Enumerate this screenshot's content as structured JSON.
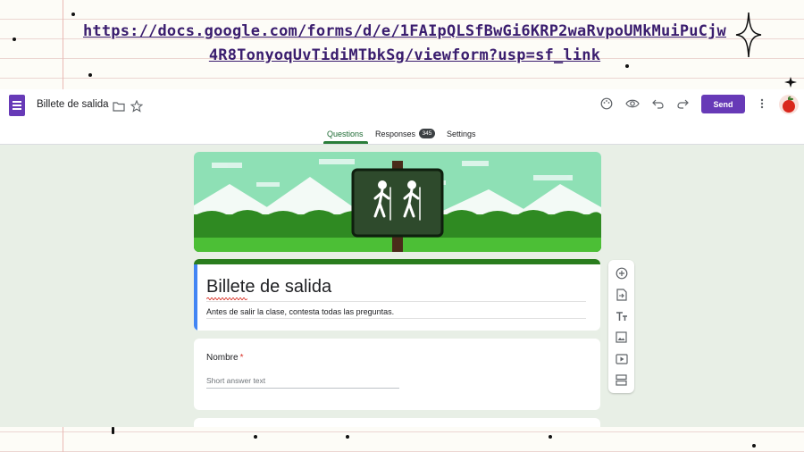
{
  "link": {
    "line1": "https://docs.google.com/forms/d/e/1FAIpQLSfBwGi6KRP2waRvpoUMkMuiPuCjw",
    "line2": "4R8TonyoqUvTidiMTbkSg/viewform?usp=sf_link"
  },
  "header": {
    "app_icon": "google-forms-icon",
    "doc_title": "Billete de salida",
    "send_label": "Send",
    "icons": [
      "folder-icon",
      "star-icon",
      "palette-icon",
      "preview-eye-icon",
      "undo-icon",
      "redo-icon",
      "more-vert-icon"
    ]
  },
  "tabs": [
    {
      "label": "Questions",
      "active": true
    },
    {
      "label": "Responses",
      "badge": "345"
    },
    {
      "label": "Settings"
    }
  ],
  "form": {
    "title": "Billete de salida",
    "description": "Antes de salir la clase, contesta todas las preguntas.",
    "questions": [
      {
        "label": "Nombre",
        "required_mark": "*",
        "placeholder": "Short answer text"
      }
    ]
  },
  "toolbar": {
    "icons": [
      "add-question-icon",
      "import-questions-icon",
      "add-title-icon",
      "add-image-icon",
      "add-video-icon",
      "add-section-icon"
    ]
  },
  "colors": {
    "brand": "#673ab7",
    "theme": "#2a7d1e",
    "background": "#e8efe6",
    "title_accent": "#4285f4"
  }
}
